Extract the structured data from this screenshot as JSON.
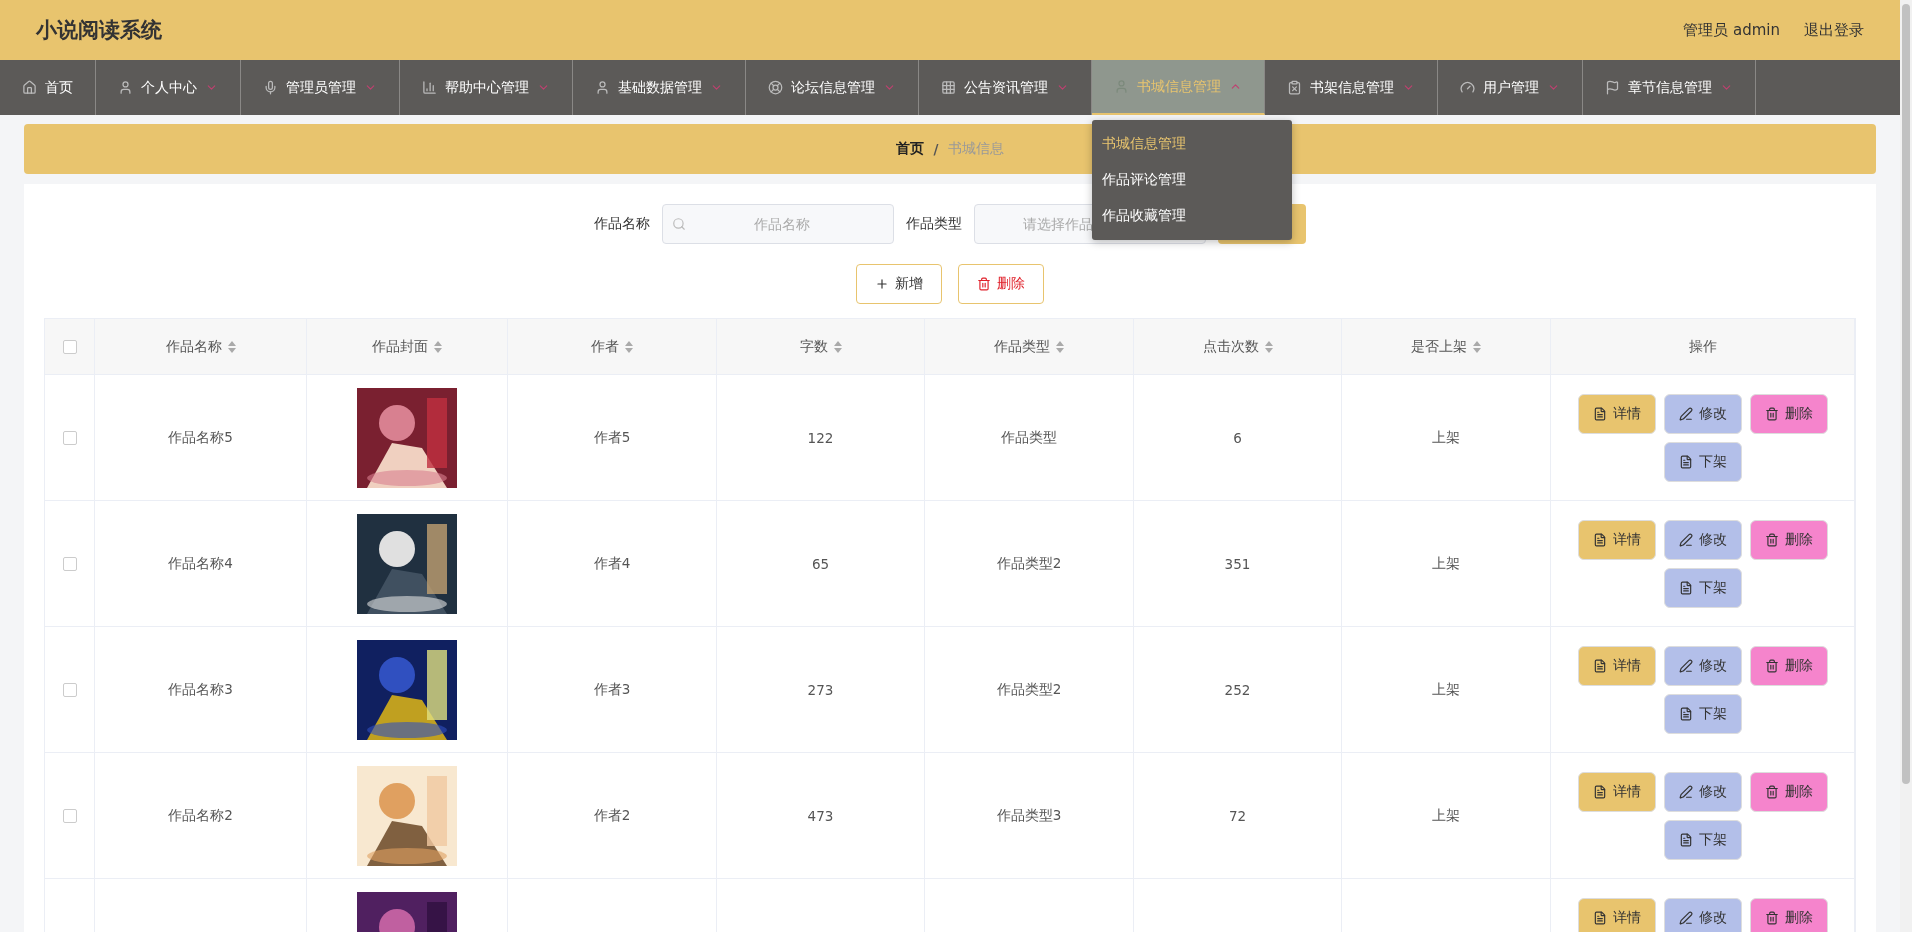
{
  "header": {
    "title": "小说阅读系统",
    "user": "管理员 admin",
    "logout": "退出登录"
  },
  "nav": [
    {
      "label": "首页",
      "selected": false
    },
    {
      "label": "个人中心",
      "selected": false,
      "expanded": false
    },
    {
      "label": "管理员管理",
      "selected": false,
      "expanded": false
    },
    {
      "label": "帮助中心管理",
      "selected": false,
      "expanded": false
    },
    {
      "label": "基础数据管理",
      "selected": false,
      "expanded": false
    },
    {
      "label": "论坛信息管理",
      "selected": false,
      "expanded": false
    },
    {
      "label": "公告资讯管理",
      "selected": false,
      "expanded": false
    },
    {
      "label": "书城信息管理",
      "selected": true,
      "expanded": true,
      "menu": [
        {
          "label": "书城信息管理",
          "selected": true
        },
        {
          "label": "作品评论管理",
          "selected": false
        },
        {
          "label": "作品收藏管理",
          "selected": false
        }
      ]
    },
    {
      "label": "书架信息管理",
      "selected": false,
      "expanded": false
    },
    {
      "label": "用户管理",
      "selected": false,
      "expanded": false
    },
    {
      "label": "章节信息管理",
      "selected": false,
      "expanded": false
    }
  ],
  "breadcrumb": [
    "首页",
    "/",
    "书城信息"
  ],
  "search": {
    "fields": [
      {
        "label": "作品名称",
        "placeholder": "作品名称",
        "kind": "text"
      },
      {
        "label": "作品类型",
        "placeholder": "请选择作品",
        "kind": "select"
      }
    ]
  },
  "toolbar": [
    {
      "label": "新增",
      "kind": "add"
    },
    {
      "label": "删除",
      "kind": "delete"
    }
  ],
  "table": {
    "all_checked": false,
    "columns": [
      {
        "label": "作品名称",
        "sortable": true
      },
      {
        "label": "作品封面",
        "sortable": true
      },
      {
        "label": "作者",
        "sortable": true
      },
      {
        "label": "字数",
        "sortable": true
      },
      {
        "label": "作品类型",
        "sortable": true
      },
      {
        "label": "点击次数",
        "sortable": true
      },
      {
        "label": "是否上架",
        "sortable": true
      },
      {
        "label": "操作",
        "sortable": false
      }
    ],
    "rows": [
      {
        "checked": false,
        "cells": [
          "作品名称5",
          null,
          "作者5",
          "122",
          "作品类型",
          "6",
          "上架"
        ],
        "actions": [
          {
            "label": "详情",
            "kind": "detail"
          },
          {
            "label": "修改",
            "kind": "edit"
          },
          {
            "label": "删除",
            "kind": "delete"
          },
          {
            "label": "下架",
            "kind": "shelf"
          }
        ]
      },
      {
        "checked": false,
        "cells": [
          "作品名称4",
          null,
          "作者4",
          "65",
          "作品类型2",
          "351",
          "上架"
        ],
        "actions": [
          {
            "label": "详情",
            "kind": "detail"
          },
          {
            "label": "修改",
            "kind": "edit"
          },
          {
            "label": "删除",
            "kind": "delete"
          },
          {
            "label": "下架",
            "kind": "shelf"
          }
        ]
      },
      {
        "checked": false,
        "cells": [
          "作品名称3",
          null,
          "作者3",
          "273",
          "作品类型2",
          "252",
          "上架"
        ],
        "actions": [
          {
            "label": "详情",
            "kind": "detail"
          },
          {
            "label": "修改",
            "kind": "edit"
          },
          {
            "label": "删除",
            "kind": "delete"
          },
          {
            "label": "下架",
            "kind": "shelf"
          }
        ]
      },
      {
        "checked": false,
        "cells": [
          "作品名称2",
          null,
          "作者2",
          "473",
          "作品类型3",
          "72",
          "上架"
        ],
        "actions": [
          {
            "label": "详情",
            "kind": "detail"
          },
          {
            "label": "修改",
            "kind": "edit"
          },
          {
            "label": "删除",
            "kind": "delete"
          },
          {
            "label": "下架",
            "kind": "shelf"
          }
        ]
      },
      {
        "cells": [
          null,
          null,
          null,
          null,
          null,
          null,
          null
        ],
        "actions": [
          {
            "label": "详情",
            "kind": "detail"
          },
          {
            "label": "修改",
            "kind": "edit"
          },
          {
            "label": "删除",
            "kind": "delete"
          }
        ]
      }
    ]
  }
}
